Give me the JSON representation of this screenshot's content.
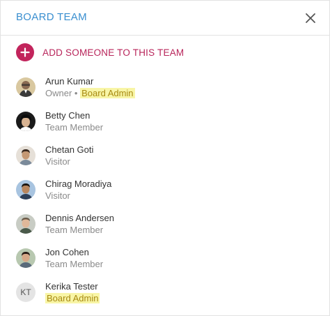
{
  "header": {
    "title": "BOARD TEAM"
  },
  "icons": {
    "close": "close-icon",
    "add": "plus-icon"
  },
  "add_member": {
    "label": "ADD SOMEONE TO THIS TEAM"
  },
  "colors": {
    "header_title": "#3a8fd0",
    "add_accent": "#c2245c",
    "admin_highlight": "#f8f5a6"
  },
  "members": [
    {
      "name": "Arun Kumar",
      "role": "Owner",
      "separator": "•",
      "badge": "Board Admin"
    },
    {
      "name": "Betty Chen",
      "role": "Team Member"
    },
    {
      "name": "Chetan Goti",
      "role": "Visitor"
    },
    {
      "name": "Chirag Moradiya",
      "role": "Visitor"
    },
    {
      "name": "Dennis Andersen",
      "role": "Team Member"
    },
    {
      "name": "Jon Cohen",
      "role": "Team Member"
    },
    {
      "name": "Kerika Tester",
      "initials": "KT",
      "badge": "Board Admin"
    }
  ]
}
